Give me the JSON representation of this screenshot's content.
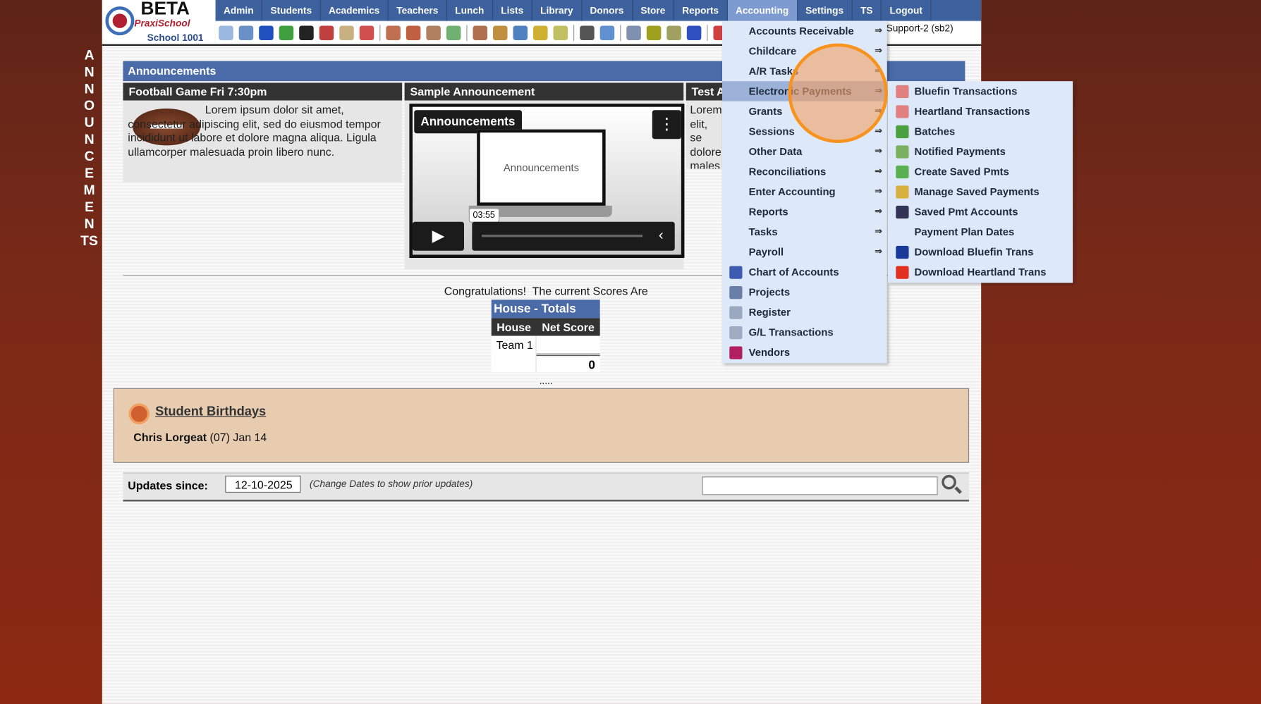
{
  "header": {
    "beta": "BETA",
    "brand": "PraxiSchool",
    "school": "School 1001",
    "user": "Support-2 (sb2)"
  },
  "nav": [
    "Admin",
    "Students",
    "Academics",
    "Teachers",
    "Lunch",
    "Lists",
    "Library",
    "Donors",
    "Store",
    "Reports",
    "Accounting",
    "Settings",
    "TS",
    "Logout"
  ],
  "active_nav": "Accounting",
  "toolbar_icons": [
    "search-icon",
    "calendar-icon",
    "email-icon",
    "sms-icon",
    "phone-icon",
    "flag-icon",
    "form-icon",
    "calendar-date-icon",
    "megaphone-icon",
    "add-student-icon",
    "student-icon",
    "money-icon",
    "parents-icon",
    "lunch-icon",
    "book-icon",
    "bell-icon",
    "export-icon",
    "teacher-icon",
    "alarm-icon",
    "spreadsheet-icon",
    "card-icon",
    "printer-icon",
    "ap-icon",
    "pdf-icon"
  ],
  "vertical_label": "ANNOUNCEMENTS",
  "announcements": {
    "title": "Announcements",
    "items": [
      {
        "title": "Football Game Fri 7:30pm",
        "body": "Lorem ipsum dolor sit amet, consectetur adipiscing elit, sed do eiusmod tempor incididunt ut labore et dolore magna aliqua. Ligula ullamcorper malesuada proin libero nunc."
      },
      {
        "title": "Sample Announcement",
        "video_title": "Announcements",
        "video_screen_text": "Announcements",
        "time": "03:55"
      },
      {
        "title": "Test A",
        "body": "Lorem elit, se dolore males"
      }
    ]
  },
  "scores": {
    "intro": "Congratulations!  The current Scores Are",
    "table_title": "House - Totals",
    "columns": [
      "House",
      "Net Score"
    ],
    "rows": [
      [
        "Team 1",
        ""
      ]
    ],
    "total": "0",
    "more": "....."
  },
  "birthdays": {
    "title": "Student Birthdays",
    "name": "Chris Lorgeat",
    "detail": " (07) Jan 14"
  },
  "updates": {
    "label": "Updates since:",
    "date": "12-10-2025",
    "note": "(Change Dates to show prior updates)",
    "search_value": ""
  },
  "accounting_menu": [
    {
      "label": "Accounts Receivable",
      "arrow": "⇒"
    },
    {
      "label": "Childcare",
      "arrow": "⇒"
    },
    {
      "label": "A/R Tasks",
      "arrow": "⇒"
    },
    {
      "label": "Electronic Payments",
      "arrow": "⇒"
    },
    {
      "label": "Grants",
      "arrow": "⇒"
    },
    {
      "label": "Sessions",
      "arrow": "⇒"
    },
    {
      "label": "Other Data",
      "arrow": "⇒"
    },
    {
      "label": "Reconciliations",
      "arrow": "⇒"
    },
    {
      "label": "Enter Accounting",
      "arrow": "⇒"
    },
    {
      "label": "Reports",
      "arrow": "⇒"
    },
    {
      "label": "Tasks",
      "arrow": "⇒"
    },
    {
      "label": "Payroll",
      "arrow": "⇒"
    },
    {
      "label": "Chart of Accounts",
      "icon": "gl-icon",
      "color": "#3d5bb0"
    },
    {
      "label": "Projects",
      "icon": "list-icon",
      "color": "#6a7fa8"
    },
    {
      "label": "Register",
      "icon": "register-icon",
      "color": "#9aa8c0"
    },
    {
      "label": "G/L Transactions",
      "icon": "ledger-icon",
      "color": "#a0aac0"
    },
    {
      "label": "Vendors",
      "icon": "store-icon",
      "color": "#b02060"
    }
  ],
  "highlighted_item": "Electronic Payments",
  "electronic_payments_menu": [
    {
      "label": "Bluefin Transactions",
      "icon": "transactions-icon",
      "color": "#e08080"
    },
    {
      "label": "Heartland Transactions",
      "icon": "transactions-icon",
      "color": "#e08080"
    },
    {
      "label": "Batches",
      "icon": "money-bag-icon",
      "color": "#4aa040"
    },
    {
      "label": "Notified Payments",
      "icon": "money-icon",
      "color": "#7ab060"
    },
    {
      "label": "Create Saved Pmts",
      "icon": "add-circle-icon",
      "color": "#5ab050"
    },
    {
      "label": "Manage Saved Payments",
      "icon": "pencil-icon",
      "color": "#d8b040"
    },
    {
      "label": "Saved Pmt Accounts",
      "icon": "eft-icon",
      "color": "#335"
    },
    {
      "label": "Payment Plan Dates",
      "icon": "",
      "color": ""
    },
    {
      "label": "Download Bluefin Trans",
      "icon": "bluefin-icon",
      "color": "#1a3a9a"
    },
    {
      "label": "Download Heartland Trans",
      "icon": "heartland-icon",
      "color": "#e03020"
    }
  ],
  "colors": {
    "nav": "#3d619c",
    "highlight_circle": "#f7931e",
    "menu_bg": "#dde9f8"
  }
}
